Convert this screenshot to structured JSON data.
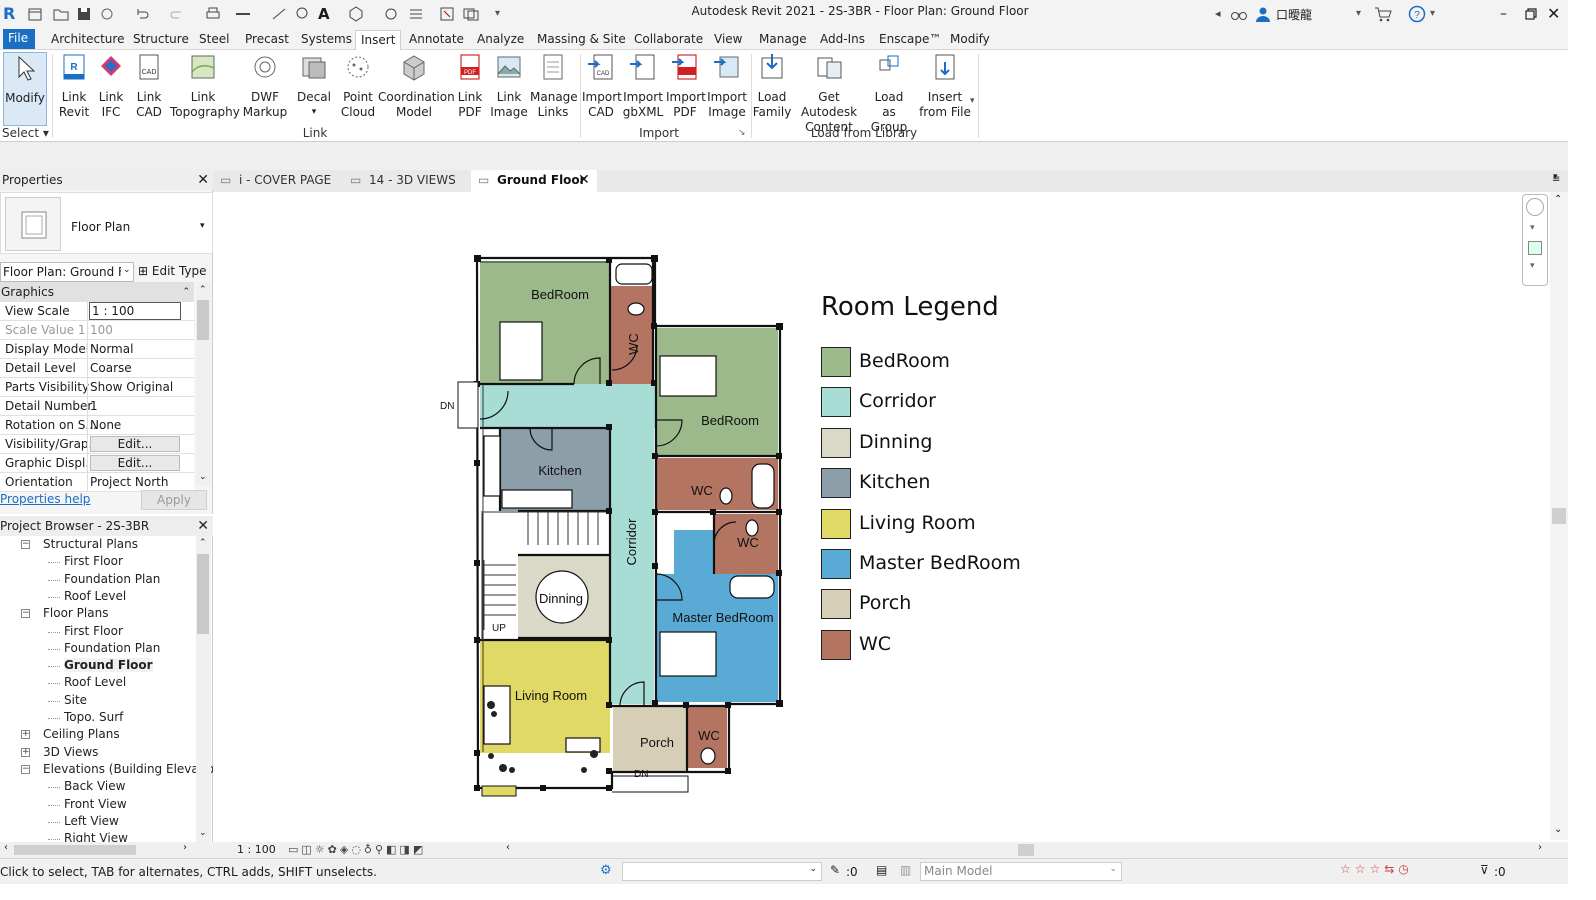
{
  "app_title": "Autodesk Revit 2021 - 2S-3BR - Floor Plan: Ground Floor",
  "user_name": "口曖龍",
  "menu": [
    "File",
    "Architecture",
    "Structure",
    "Steel",
    "Precast",
    "Systems",
    "Insert",
    "Annotate",
    "Analyze",
    "Massing & Site",
    "Collaborate",
    "View",
    "Manage",
    "Add-Ins",
    "Enscape™",
    "Modify"
  ],
  "ribbon": {
    "modify": "Modify",
    "select_group": "Select",
    "link_buttons": [
      [
        "Link",
        "Revit"
      ],
      [
        "Link",
        "IFC"
      ],
      [
        "Link",
        "CAD"
      ],
      [
        "Link",
        "Topography"
      ],
      [
        "DWF",
        "Markup"
      ],
      [
        "Decal",
        ""
      ],
      [
        "Point",
        "Cloud"
      ],
      [
        "Coordination",
        "Model"
      ],
      [
        "Link",
        "PDF"
      ],
      [
        "Link",
        "Image"
      ],
      [
        "Manage",
        "Links"
      ]
    ],
    "link_group": "Link",
    "import_buttons": [
      [
        "Import",
        "CAD"
      ],
      [
        "Import",
        "gbXML"
      ],
      [
        "Import",
        "PDF"
      ],
      [
        "Import",
        "Image"
      ]
    ],
    "import_group": "Import",
    "library_buttons": [
      [
        "Load",
        "Family"
      ],
      [
        "Get Autodesk",
        "Content"
      ],
      [
        "Load as",
        "Group"
      ],
      [
        "Insert",
        "from File"
      ]
    ],
    "library_group": "Load from Library"
  },
  "tabs": [
    {
      "label": "i - COVER PAGE"
    },
    {
      "label": "14 - 3D VIEWS"
    },
    {
      "label": "Ground Floor"
    }
  ],
  "properties": {
    "title": "Properties",
    "type_name": "Floor Plan",
    "instance_selector": "Floor Plan: Ground Flc",
    "edit_type": "Edit Type",
    "section": "Graphics",
    "rows": [
      {
        "key": "View Scale",
        "value": "1 : 100"
      },
      {
        "key": "Scale Value    1:",
        "value": "100"
      },
      {
        "key": "Display Model",
        "value": "Normal"
      },
      {
        "key": "Detail Level",
        "value": "Coarse"
      },
      {
        "key": "Parts Visibility",
        "value": "Show Original"
      },
      {
        "key": "Detail Number",
        "value": "1"
      },
      {
        "key": "Rotation on S...",
        "value": "None"
      },
      {
        "key": "Visibility/Grap...",
        "value": "Edit..."
      },
      {
        "key": "Graphic Displ...",
        "value": "Edit..."
      },
      {
        "key": "Orientation",
        "value": "Project North"
      }
    ],
    "help": "Properties help",
    "apply": "Apply"
  },
  "browser": {
    "title": "Project Browser - 2S-3BR",
    "items": [
      {
        "label": "Structural Plans",
        "level": 1,
        "toggle": "−"
      },
      {
        "label": "First Floor",
        "level": 2
      },
      {
        "label": "Foundation Plan",
        "level": 2
      },
      {
        "label": "Roof Level",
        "level": 2
      },
      {
        "label": "Floor Plans",
        "level": 1,
        "toggle": "−"
      },
      {
        "label": "First Floor",
        "level": 2
      },
      {
        "label": "Foundation Plan",
        "level": 2
      },
      {
        "label": "Ground Floor",
        "level": 2,
        "bold": true
      },
      {
        "label": "Roof Level",
        "level": 2
      },
      {
        "label": "Site",
        "level": 2
      },
      {
        "label": "Topo. Surf",
        "level": 2
      },
      {
        "label": "Ceiling Plans",
        "level": 1,
        "toggle": "+"
      },
      {
        "label": "3D Views",
        "level": 1,
        "toggle": "+"
      },
      {
        "label": "Elevations (Building Elevatio",
        "level": 1,
        "toggle": "−"
      },
      {
        "label": "Back View",
        "level": 2
      },
      {
        "label": "Front View",
        "level": 2
      },
      {
        "label": "Left View",
        "level": 2
      },
      {
        "label": "Right View",
        "level": 2
      }
    ]
  },
  "plan": {
    "rooms": [
      "BedRoom",
      "WC",
      "BedRoom",
      "Kitchen",
      "Corridor",
      "WC",
      "WC",
      "Dinning",
      "Master BedRoom",
      "Living Room",
      "Porch",
      "WC"
    ],
    "stair_up": "UP",
    "stair_dn": "DN",
    "door_dn": "DN"
  },
  "legend": {
    "title": "Room Legend",
    "items": [
      {
        "label": "BedRoom",
        "color": "#9cb98b"
      },
      {
        "label": "Corridor",
        "color": "#a8ddd6"
      },
      {
        "label": "Dinning",
        "color": "#dad9c7"
      },
      {
        "label": "Kitchen",
        "color": "#8c9ea8"
      },
      {
        "label": "Living Room",
        "color": "#e0d965"
      },
      {
        "label": "Master BedRoom",
        "color": "#5aaad6"
      },
      {
        "label": "Porch",
        "color": "#d6ceb6"
      },
      {
        "label": "WC",
        "color": "#b47462"
      }
    ]
  },
  "viewbar": {
    "scale": "1 : 100"
  },
  "status": {
    "message": "Click to select, TAB for alternates, CTRL adds, SHIFT unselects.",
    "count": ":0",
    "model": "Main Model",
    "filter": ":0"
  }
}
